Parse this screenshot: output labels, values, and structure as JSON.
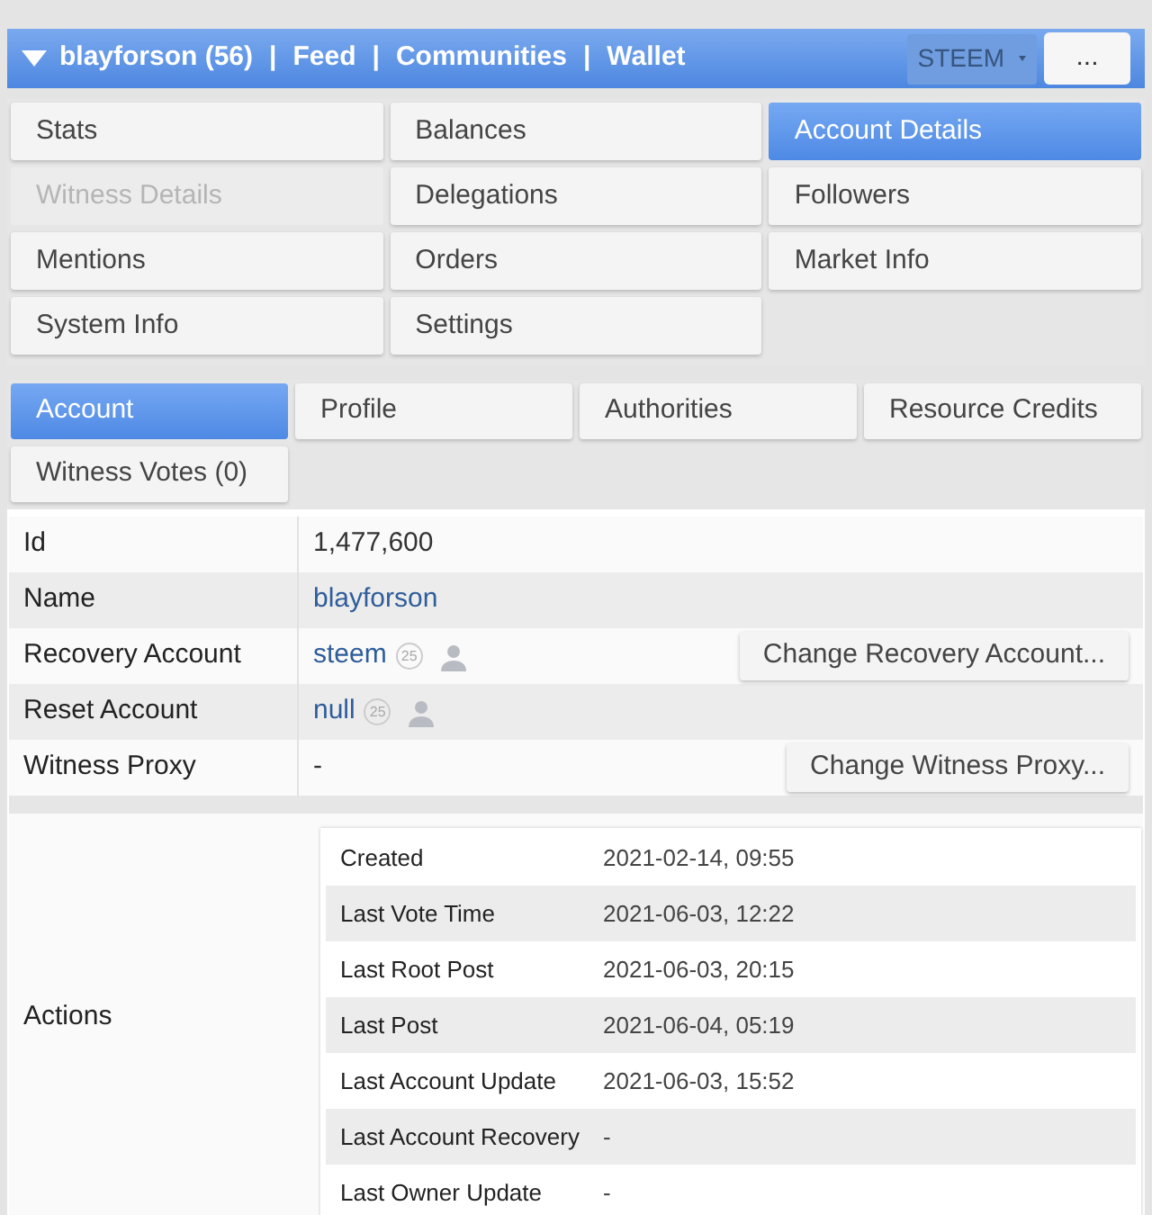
{
  "header": {
    "nav": [
      {
        "kind": "link",
        "text": "blayforson (56)"
      },
      {
        "kind": "separator",
        "text": "|"
      },
      {
        "kind": "link",
        "text": "Feed"
      },
      {
        "kind": "separator",
        "text": "|"
      },
      {
        "kind": "link",
        "text": "Communities"
      },
      {
        "kind": "separator",
        "text": "|"
      },
      {
        "kind": "link",
        "text": "Wallet"
      }
    ],
    "chain_select": {
      "value": "STEEM"
    },
    "more_button": "..."
  },
  "menu": [
    {
      "label": "Stats",
      "selected": false,
      "disabled": false
    },
    {
      "label": "Balances",
      "selected": false,
      "disabled": false
    },
    {
      "label": "Account Details",
      "selected": true,
      "disabled": false
    },
    {
      "label": "Witness Details",
      "selected": false,
      "disabled": true
    },
    {
      "label": "Delegations",
      "selected": false,
      "disabled": false
    },
    {
      "label": "Followers",
      "selected": false,
      "disabled": false
    },
    {
      "label": "Mentions",
      "selected": false,
      "disabled": false
    },
    {
      "label": "Orders",
      "selected": false,
      "disabled": false
    },
    {
      "label": "Market Info",
      "selected": false,
      "disabled": false
    },
    {
      "label": "System Info",
      "selected": false,
      "disabled": false
    },
    {
      "label": "Settings",
      "selected": false,
      "disabled": false
    }
  ],
  "tabs": [
    {
      "label": "Account",
      "selected": true
    },
    {
      "label": "Profile",
      "selected": false
    },
    {
      "label": "Authorities",
      "selected": false
    },
    {
      "label": "Resource Credits",
      "selected": false
    },
    {
      "label": "Witness Votes (0)",
      "selected": false
    }
  ],
  "details": [
    {
      "label": "Id",
      "kind": "text",
      "value": "1,477,600"
    },
    {
      "label": "Name",
      "kind": "link",
      "value": "blayforson"
    },
    {
      "label": "Recovery Account",
      "kind": "account",
      "value": "steem",
      "badge": "25",
      "button": "Change Recovery Account..."
    },
    {
      "label": "Reset Account",
      "kind": "account",
      "value": "null",
      "badge": "25"
    },
    {
      "label": "Witness Proxy",
      "kind": "text",
      "value": "-",
      "button": "Change Witness Proxy..."
    }
  ],
  "actions": {
    "label": "Actions",
    "rows": [
      {
        "label": "Created",
        "value": "2021-02-14, 09:55"
      },
      {
        "label": "Last Vote Time",
        "value": "2021-06-03, 12:22"
      },
      {
        "label": "Last Root Post",
        "value": "2021-06-03, 20:15"
      },
      {
        "label": "Last Post",
        "value": "2021-06-04, 05:19"
      },
      {
        "label": "Last Account Update",
        "value": "2021-06-03, 15:52"
      },
      {
        "label": "Last Account Recovery",
        "value": "-"
      },
      {
        "label": "Last Owner Update",
        "value": "-"
      }
    ]
  }
}
